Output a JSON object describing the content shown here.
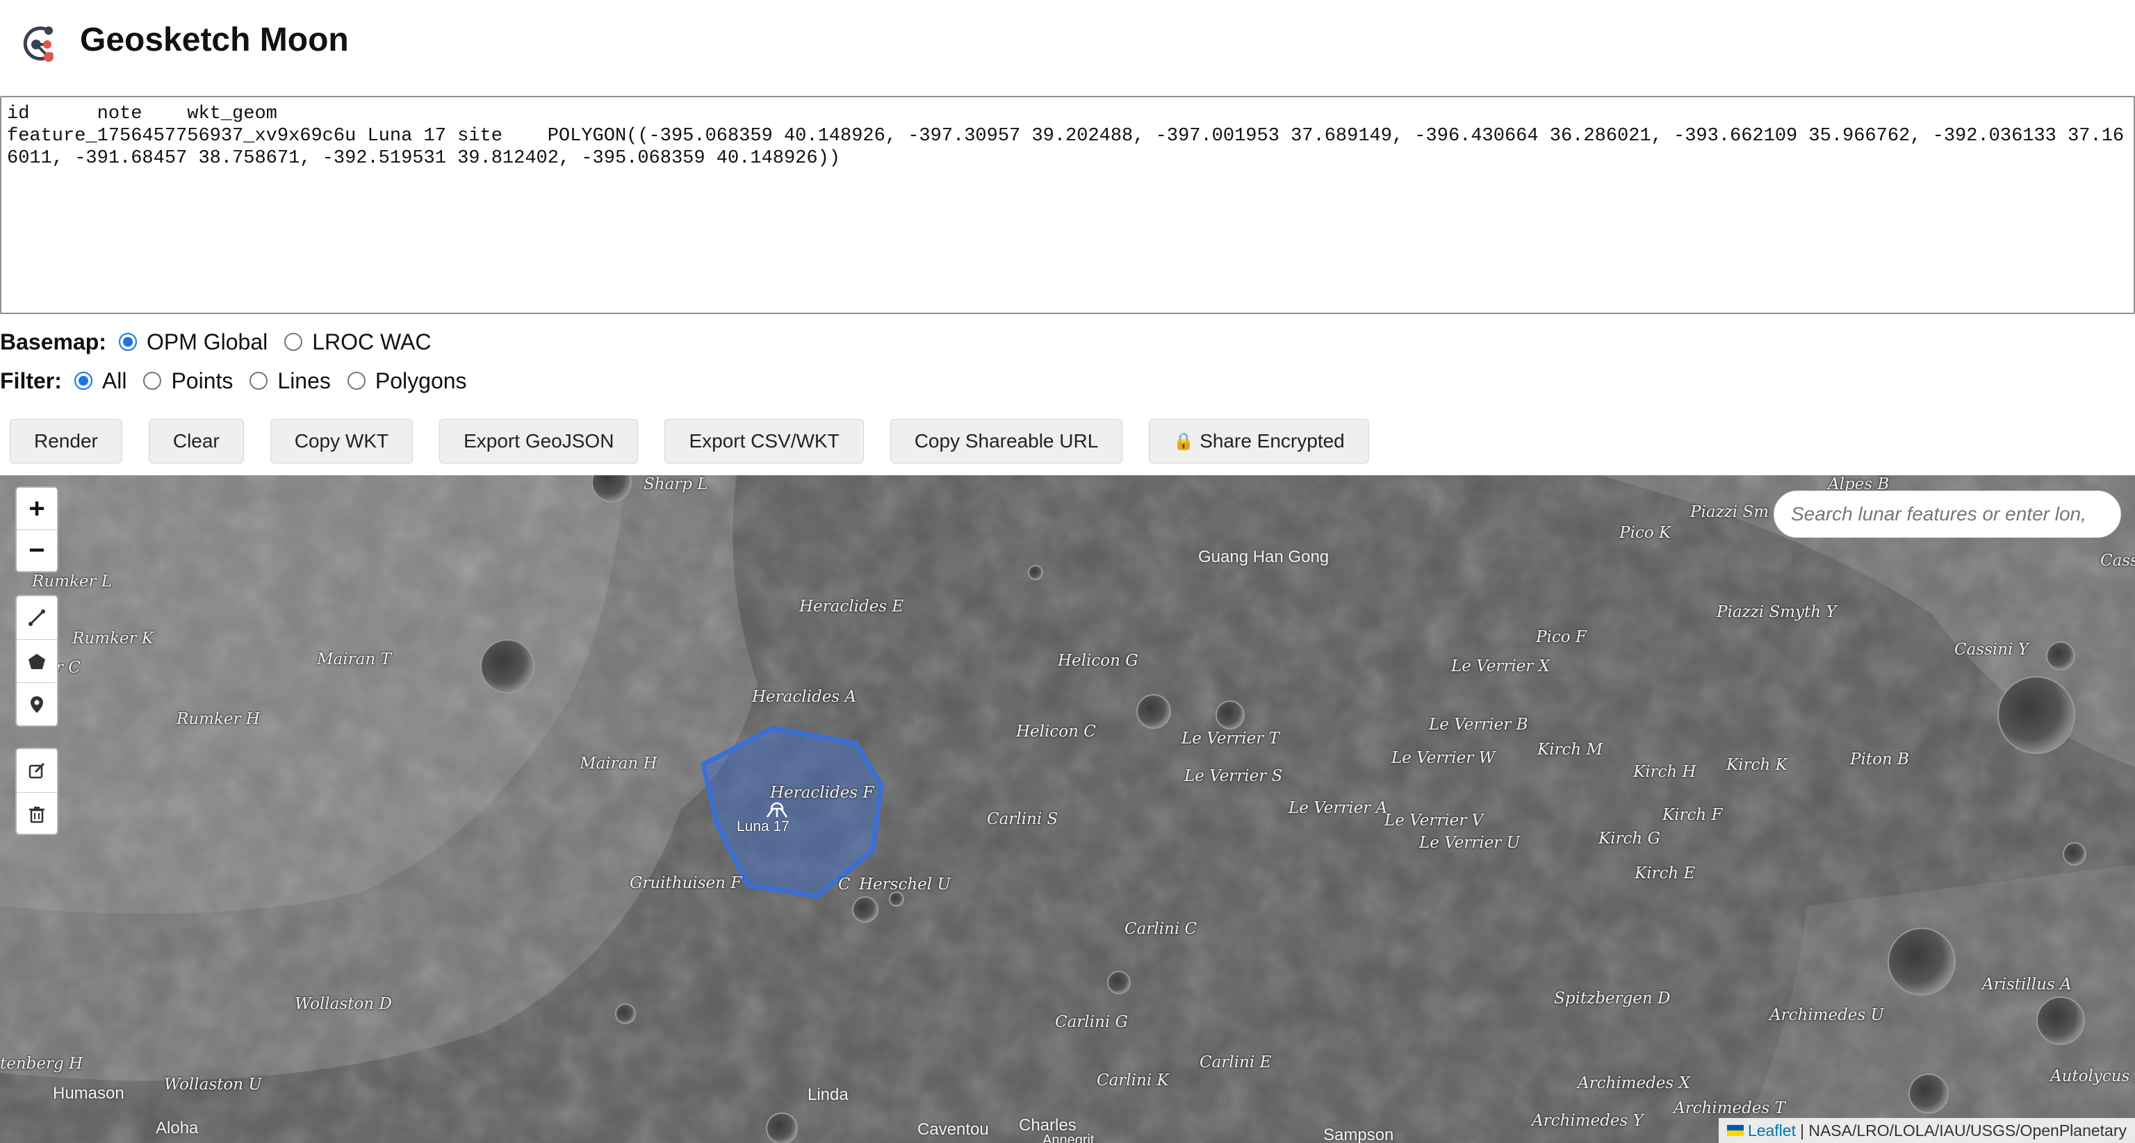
{
  "app": {
    "title": "Geosketch Moon"
  },
  "data_table": {
    "text": "id      note    wkt_geom\nfeature_1756457756937_xv9x69c6u Luna 17 site    POLYGON((-395.068359 40.148926, -397.30957 39.202488, -397.001953 37.689149, -396.430664 36.286021, -393.662109 35.966762, -392.036133 37.166011, -391.68457 38.758671, -392.519531 39.812402, -395.068359 40.148926))"
  },
  "basemap": {
    "label": "Basemap:",
    "options": [
      {
        "label": "OPM Global",
        "selected": true
      },
      {
        "label": "LROC WAC",
        "selected": false
      }
    ]
  },
  "filter": {
    "label": "Filter:",
    "options": [
      {
        "label": "All",
        "selected": true
      },
      {
        "label": "Points",
        "selected": false
      },
      {
        "label": "Lines",
        "selected": false
      },
      {
        "label": "Polygons",
        "selected": false
      }
    ]
  },
  "toolbar": {
    "render": "Render",
    "clear": "Clear",
    "copy_wkt": "Copy WKT",
    "export_geojson": "Export GeoJSON",
    "export_csv": "Export CSV/WKT",
    "copy_url": "Copy Shareable URL",
    "share_encrypted": "Share Encrypted"
  },
  "map": {
    "zoom_in": "+",
    "zoom_out": "−",
    "search_placeholder": "Search lunar features or enter lon,",
    "polygon_label": "Luna 17",
    "polygon_color": "#3b6fd4",
    "attribution_link": "Leaflet",
    "attribution_text": "| NASA/LRO/LOLA/IAU/USGS/OpenPlanetary",
    "features": {
      "sharp_l": "Sharp L",
      "rumker_l": "Rumker L",
      "rumker_k": "Rumker K",
      "rumker_c": "r C",
      "mairan_t": "Mairan T",
      "rumker_h": "Rumker H",
      "heraclides_e": "Heraclides E",
      "heraclides_a": "Heraclides A",
      "heraclides_f": "Heraclides F",
      "mairan_h": "Mairan H",
      "gruithuisen_f": "Gruithuisen F",
      "c_label": "C",
      "herschel_u": "Herschel U",
      "helicon_g": "Helicon G",
      "helicon_c": "Helicon C",
      "carlini_s": "Carlini S",
      "carlini_c": "Carlini C",
      "carlini_g": "Carlini G",
      "carlini_k": "Carlini K",
      "carlini_e": "Carlini E",
      "le_verrier_t": "Le Verrier T",
      "le_verrier_s": "Le Verrier S",
      "le_verrier_a": "Le Verrier A",
      "le_verrier_v": "Le Verrier V",
      "le_verrier_u": "Le Verrier U",
      "le_verrier_w": "Le Verrier W",
      "le_verrier_b": "Le Verrier B",
      "le_verrier_x": "Le Verrier X",
      "kirch_m": "Kirch M",
      "kirch_h": "Kirch H",
      "kirch_k": "Kirch K",
      "kirch_f": "Kirch F",
      "kirch_g": "Kirch G",
      "kirch_e": "Kirch E",
      "pico_k": "Pico K",
      "pico_f": "Pico F",
      "piazzi_sm": "Piazzi Sm",
      "piazzi_smyth_y": "Piazzi Smyth Y",
      "alpes_b": "Alpes B",
      "cass": "Cass",
      "cassini_y": "Cassini Y",
      "piton_b": "Piton B",
      "spitzbergen_d": "Spitzbergen D",
      "archimedes_u": "Archimedes U",
      "archimedes_x": "Archimedes X",
      "archimedes_t": "Archimedes T",
      "archimedes_y": "Archimedes Y",
      "aristillus_a": "Aristillus A",
      "autolycus_k": "Autolycus K",
      "wollaston_d": "Wollaston D",
      "wollaston_u": "Wollaston U",
      "tenberg_h": "tenberg H"
    },
    "places": {
      "guang_han_gong": "Guang Han Gong",
      "humason": "Humason",
      "aloha": "Aloha",
      "linda": "Linda",
      "caventou": "Caventou",
      "charles": "Charles",
      "annegrit": "Annegrit",
      "sampson": "Sampson"
    }
  }
}
